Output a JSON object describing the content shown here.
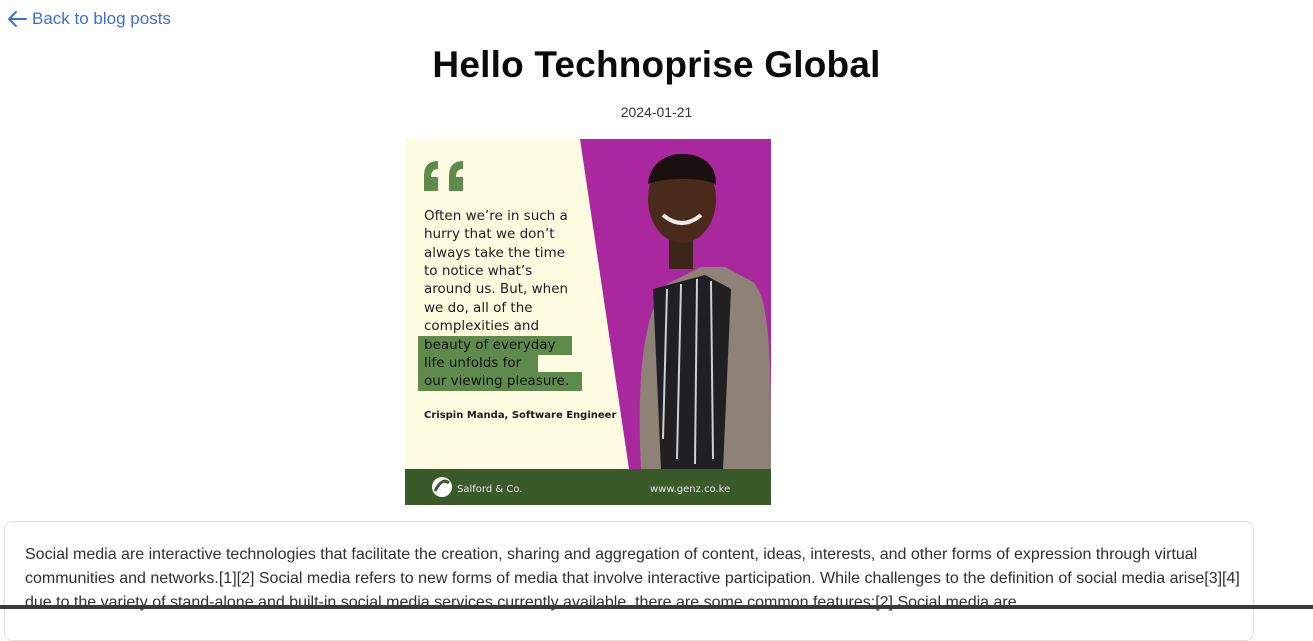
{
  "nav": {
    "back_label": "Back to blog posts"
  },
  "post": {
    "title": "Hello Technoprise Global",
    "date": "2024-01-21",
    "body": "Social media are interactive technologies that facilitate the creation, sharing and aggregation of content, ideas, interests, and other forms of expression through virtual communities and networks.[1][2] Social media refers to new forms of media that involve interactive participation. While challenges to the definition of social media arise[3][4] due to the variety of stand-alone and built-in social media services currently available, there are some common features:[2] Social media are"
  },
  "image": {
    "quote_lines": [
      "Often we’re in such a",
      "hurry that we don’t",
      "always take the time",
      "to notice what’s",
      "around us. But, when",
      "we do, all of the",
      "complexities and"
    ],
    "highlight_lines": [
      "beauty of everyday",
      "life unfolds for",
      "our viewing pleasure."
    ],
    "attribution": "Crispin Manda, Software  Engineer",
    "brand": "Salford & Co.",
    "website": "www.genz.co.ke",
    "colors": {
      "cream": "#fdfce0",
      "magenta": "#a9289e",
      "green": "#5e8a4c",
      "dark_green": "#3a5a2a"
    }
  }
}
